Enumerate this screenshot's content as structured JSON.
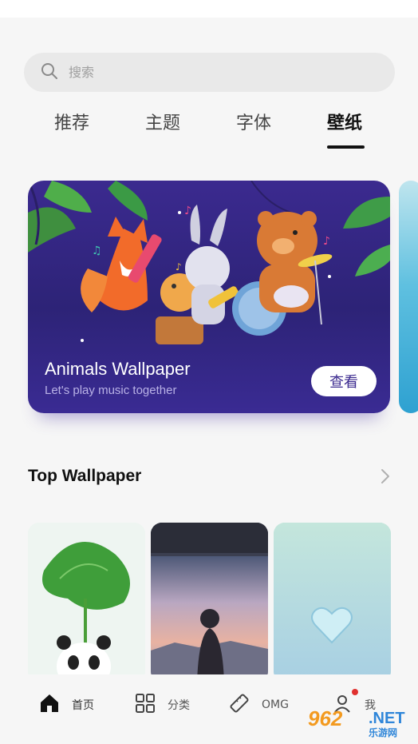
{
  "search": {
    "placeholder": "搜索"
  },
  "tabs": [
    {
      "label": "推荐",
      "active": false
    },
    {
      "label": "主题",
      "active": false
    },
    {
      "label": "字体",
      "active": false
    },
    {
      "label": "壁纸",
      "active": true
    }
  ],
  "banner": {
    "title": "Animals Wallpaper",
    "subtitle": "Let's play music together",
    "button": "查看"
  },
  "section": {
    "title": "Top Wallpaper"
  },
  "bottom_nav": [
    {
      "label": "首页",
      "icon": "home-icon",
      "active": true
    },
    {
      "label": "分类",
      "icon": "grid-icon",
      "active": false
    },
    {
      "label": "OMG",
      "icon": "pencil-ruler-icon",
      "active": false
    },
    {
      "label": "我",
      "icon": "person-icon",
      "active": false,
      "badge": true
    }
  ],
  "watermark": {
    "brand": "962",
    "domain": ".NET",
    "site": "乐游网"
  },
  "colors": {
    "accent": "#3b2a8f",
    "badge": "#e0302f"
  }
}
